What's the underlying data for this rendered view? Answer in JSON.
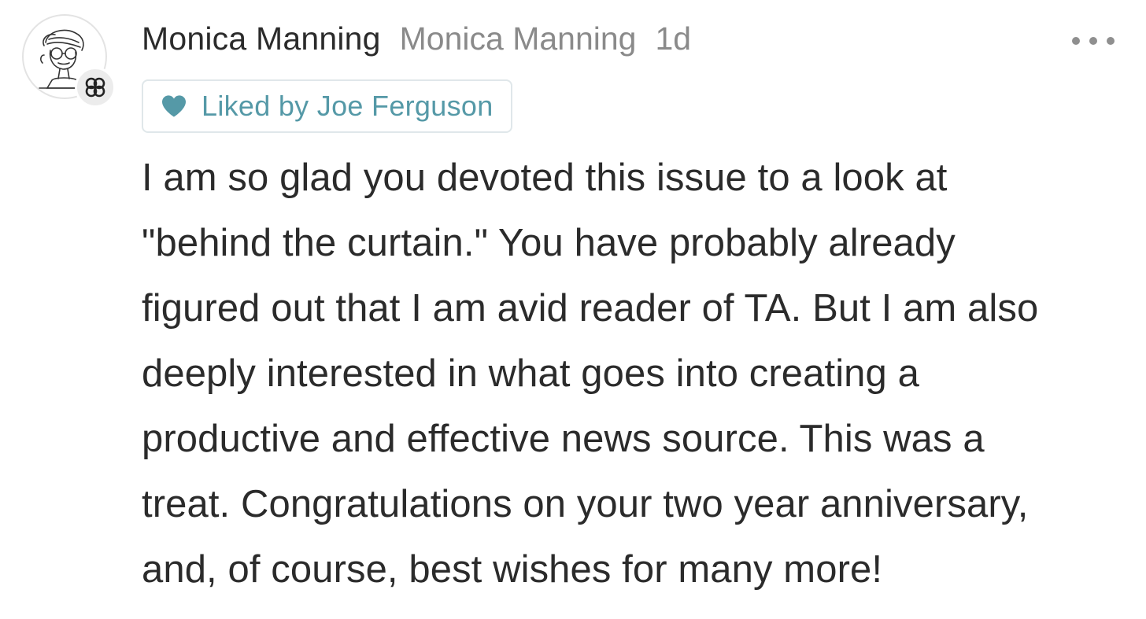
{
  "comment": {
    "author_name": "Monica Manning",
    "author_handle": "Monica Manning",
    "timestamp": "1d",
    "liked_by": "Liked by Joe Ferguson",
    "body_lines": [
      "I am so glad you devoted this issue to a look at",
      "\"behind the curtain.\" You have probably already",
      "figured out that I am avid reader of TA. But I am also",
      "deeply interested in what goes into creating a",
      "productive and effective news source. This was a",
      "treat. Congratulations on your two year anniversary,",
      "and, of course, best wishes for many more!"
    ]
  },
  "icons": {
    "more": "ellipsis-icon",
    "heart": "heart-icon",
    "badge": "supporter-badge-icon"
  },
  "colors": {
    "text": "#2b2b2b",
    "muted": "#8a8a8a",
    "accent": "#5599a7",
    "pill_border": "#e0e7ea"
  }
}
